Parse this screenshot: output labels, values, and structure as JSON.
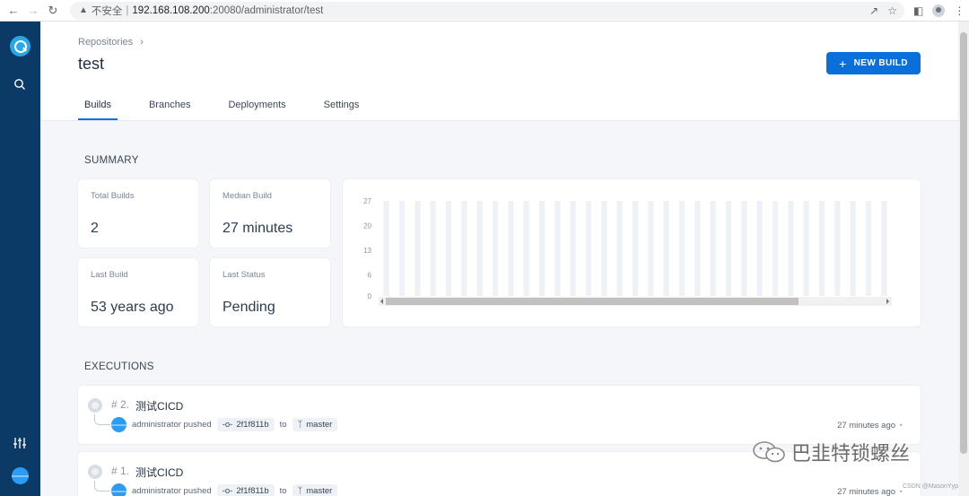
{
  "browser": {
    "insecure_label": "不安全",
    "separator": "|",
    "host": "192.168.108.200",
    "path": ":20080/administrator/test"
  },
  "header": {
    "breadcrumb": "Repositories",
    "title": "test",
    "new_build_label": "NEW BUILD"
  },
  "tabs": [
    {
      "label": "Builds",
      "active": true
    },
    {
      "label": "Branches",
      "active": false
    },
    {
      "label": "Deployments",
      "active": false
    },
    {
      "label": "Settings",
      "active": false
    }
  ],
  "summary": {
    "title": "SUMMARY",
    "cards": [
      {
        "label": "Total Builds",
        "value": "2"
      },
      {
        "label": "Median Build",
        "value": "27 minutes"
      },
      {
        "label": "Last Build",
        "value": "53 years ago"
      },
      {
        "label": "Last Status",
        "value": "Pending"
      }
    ]
  },
  "chart_data": {
    "type": "bar",
    "title": "",
    "xlabel": "",
    "ylabel": "",
    "y_ticks": [
      27,
      20,
      13,
      6,
      0
    ],
    "ylim": [
      0,
      27
    ],
    "bar_count": 33,
    "grid": false,
    "scrollbar": true
  },
  "executions": {
    "title": "EXECUTIONS",
    "items": [
      {
        "number": "# 2.",
        "name": "测试CICD",
        "actor": "administrator pushed",
        "commit": "2f1f811b",
        "to": "to",
        "branch": "master",
        "time": "27 minutes ago"
      },
      {
        "number": "# 1.",
        "name": "测试CICD",
        "actor": "administrator pushed",
        "commit": "2f1f811b",
        "to": "to",
        "branch": "master",
        "time": "27 minutes ago"
      }
    ]
  },
  "watermark": {
    "text": "巴韭特锁螺丝",
    "source": "CSDN @MasonYyp"
  },
  "colors": {
    "rail": "#0b3a66",
    "primary": "#0a6fd8"
  }
}
